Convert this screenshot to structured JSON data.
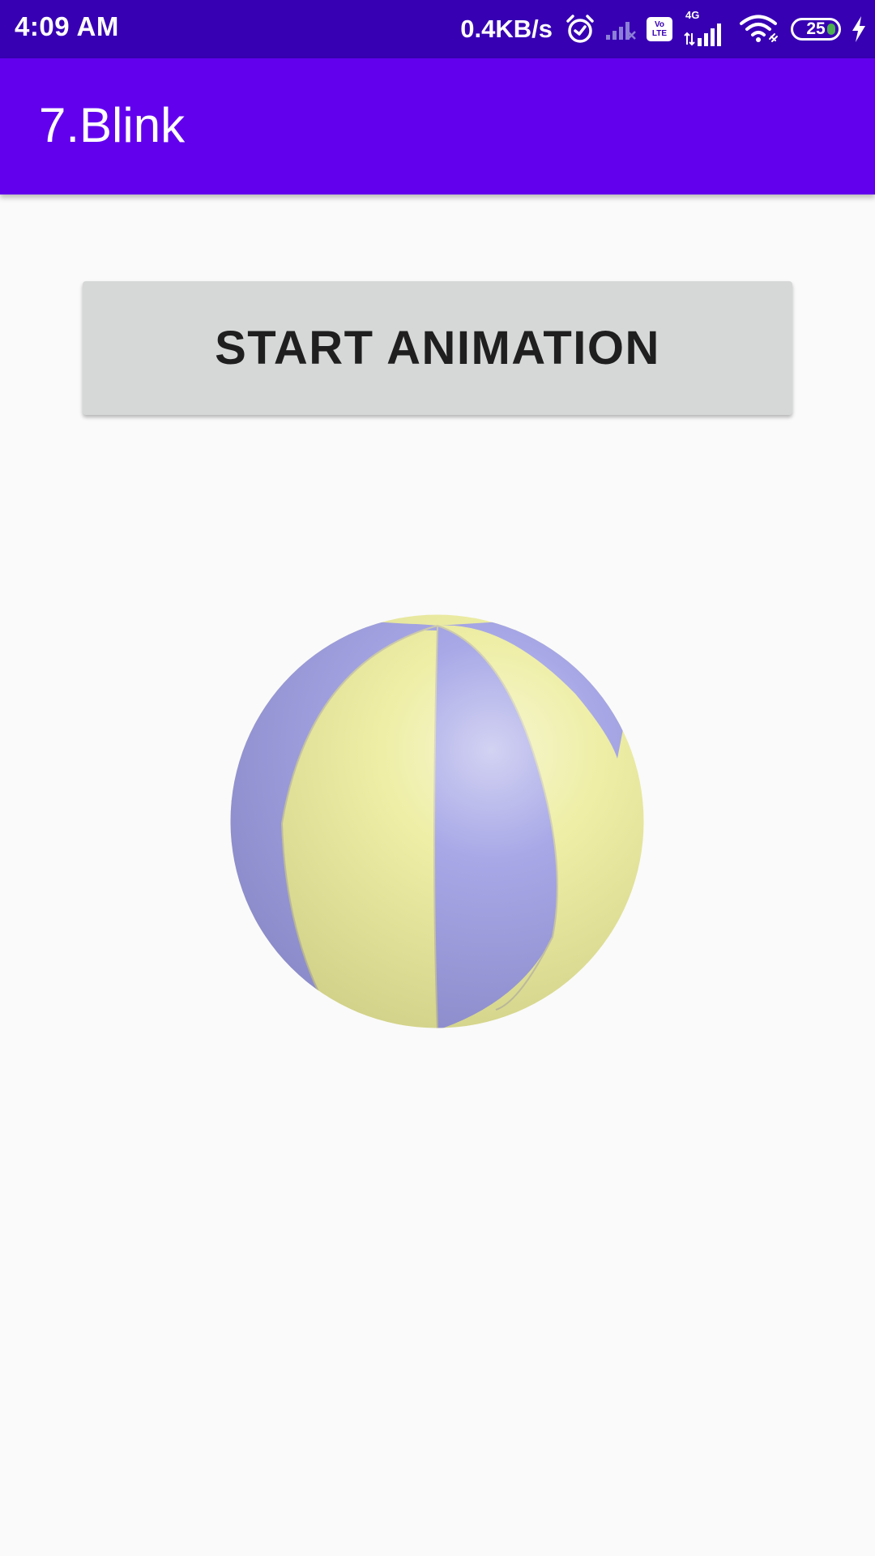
{
  "status_bar": {
    "time": "4:09 AM",
    "net_speed": "0.4KB/s",
    "volte_top": "Vo",
    "volte_bottom": "LTE",
    "net_type": "4G",
    "battery_level": "25",
    "icons": [
      "alarm-icon",
      "signal-off-icon",
      "volte-icon",
      "signal-icon",
      "wifi-icon",
      "battery-icon",
      "charging-icon"
    ],
    "bg_color": "#3700b3"
  },
  "app_bar": {
    "title": "7.Blink",
    "bg_color": "#6200ee"
  },
  "main": {
    "start_button_label": "START ANIMATION",
    "image_icon": "beach-ball-image"
  }
}
